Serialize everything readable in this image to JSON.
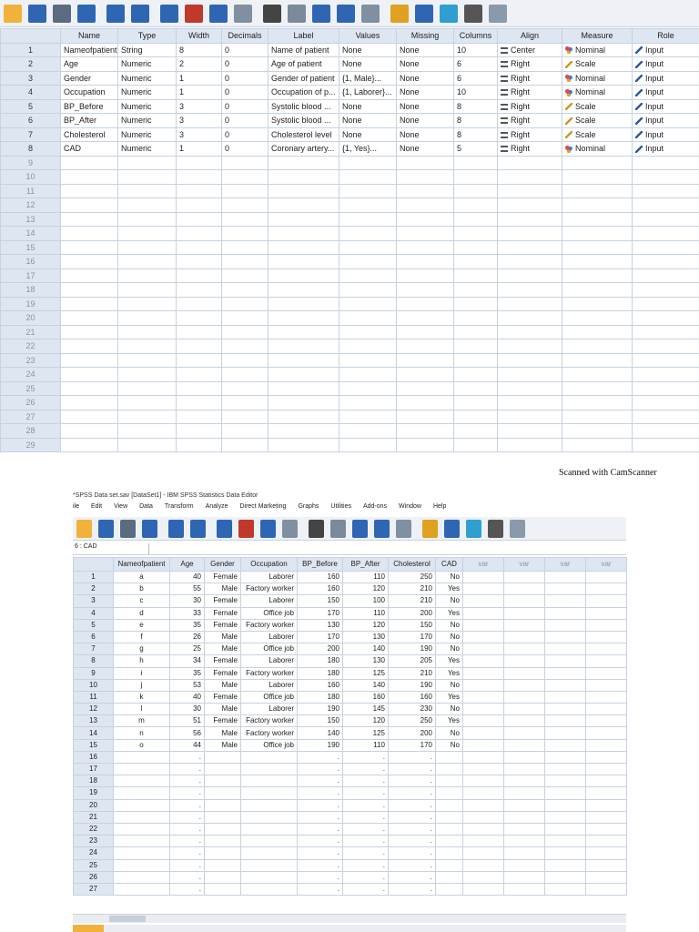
{
  "toolbar_icons": [
    "open-folder",
    "save",
    "print",
    "recall-dialog",
    "undo",
    "redo",
    "goto-case",
    "goto-variable",
    "variables",
    "descriptive",
    "find",
    "insert-cases",
    "insert-variable",
    "split-file",
    "weight-cases",
    "select-cases",
    "value-labels",
    "use-sets",
    "show-all",
    "spell-check"
  ],
  "variable_view": {
    "headers": [
      "Name",
      "Type",
      "Width",
      "Decimals",
      "Label",
      "Values",
      "Missing",
      "Columns",
      "Align",
      "Measure",
      "Role"
    ],
    "rows": [
      {
        "n": "1",
        "name": "Nameofpatient",
        "type": "String",
        "width": "8",
        "dec": "0",
        "label": "Name of patient",
        "values": "None",
        "missing": "None",
        "columns": "10",
        "align": "Center",
        "measure": "Nominal",
        "role": "Input"
      },
      {
        "n": "2",
        "name": "Age",
        "type": "Numeric",
        "width": "2",
        "dec": "0",
        "label": "Age of patient",
        "values": "None",
        "missing": "None",
        "columns": "6",
        "align": "Right",
        "measure": "Scale",
        "role": "Input"
      },
      {
        "n": "3",
        "name": "Gender",
        "type": "Numeric",
        "width": "1",
        "dec": "0",
        "label": "Gender of patient",
        "values": "{1, Male}...",
        "missing": "None",
        "columns": "6",
        "align": "Right",
        "measure": "Nominal",
        "role": "Input"
      },
      {
        "n": "4",
        "name": "Occupation",
        "type": "Numeric",
        "width": "1",
        "dec": "0",
        "label": "Occupation of p...",
        "values": "{1, Laborer}...",
        "missing": "None",
        "columns": "10",
        "align": "Right",
        "measure": "Nominal",
        "role": "Input"
      },
      {
        "n": "5",
        "name": "BP_Before",
        "type": "Numeric",
        "width": "3",
        "dec": "0",
        "label": "Systolic blood ...",
        "values": "None",
        "missing": "None",
        "columns": "8",
        "align": "Right",
        "measure": "Scale",
        "role": "Input"
      },
      {
        "n": "6",
        "name": "BP_After",
        "type": "Numeric",
        "width": "3",
        "dec": "0",
        "label": "Systolic blood ...",
        "values": "None",
        "missing": "None",
        "columns": "8",
        "align": "Right",
        "measure": "Scale",
        "role": "Input"
      },
      {
        "n": "7",
        "name": "Cholesterol",
        "type": "Numeric",
        "width": "3",
        "dec": "0",
        "label": "Cholesterol level",
        "values": "None",
        "missing": "None",
        "columns": "8",
        "align": "Right",
        "measure": "Scale",
        "role": "Input"
      },
      {
        "n": "8",
        "name": "CAD",
        "type": "Numeric",
        "width": "1",
        "dec": "0",
        "label": "Coronary artery...",
        "values": "{1, Yes}...",
        "missing": "None",
        "columns": "5",
        "align": "Right",
        "measure": "Nominal",
        "role": "Input"
      }
    ],
    "empty_rows": [
      "9",
      "10",
      "11",
      "12",
      "13",
      "14",
      "15",
      "16",
      "17",
      "18",
      "19",
      "20",
      "21",
      "22",
      "23",
      "24",
      "25",
      "26",
      "27",
      "28",
      "29"
    ]
  },
  "scanner_mark": "Scanned with CamScanner",
  "data_editor": {
    "title": "*SPSS Data set.sav [DataSet1] - IBM SPSS Statistics Data Editor",
    "menu": [
      "ile",
      "Edit",
      "View",
      "Data",
      "Transform",
      "Analyze",
      "Direct Marketing",
      "Graphs",
      "Utilities",
      "Add-ons",
      "Window",
      "Help"
    ],
    "cell_ref": "6 : CAD",
    "headers": [
      "Nameofpatient",
      "Age",
      "Gender",
      "Occupation",
      "BP_Before",
      "BP_After",
      "Cholesterol",
      "CAD",
      "var",
      "var",
      "var",
      "var"
    ],
    "rows": [
      [
        "1",
        "a",
        "40",
        "Female",
        "Laborer",
        "160",
        "110",
        "250",
        "No"
      ],
      [
        "2",
        "b",
        "55",
        "Male",
        "Factory worker",
        "160",
        "120",
        "210",
        "Yes"
      ],
      [
        "3",
        "c",
        "30",
        "Female",
        "Laborer",
        "150",
        "100",
        "210",
        "No"
      ],
      [
        "4",
        "d",
        "33",
        "Female",
        "Office job",
        "170",
        "110",
        "200",
        "Yes"
      ],
      [
        "5",
        "e",
        "35",
        "Female",
        "Factory worker",
        "130",
        "120",
        "150",
        "No"
      ],
      [
        "6",
        "f",
        "26",
        "Male",
        "Laborer",
        "170",
        "130",
        "170",
        "No"
      ],
      [
        "7",
        "g",
        "25",
        "Male",
        "Office job",
        "200",
        "140",
        "190",
        "No"
      ],
      [
        "8",
        "h",
        "34",
        "Female",
        "Laborer",
        "180",
        "130",
        "205",
        "Yes"
      ],
      [
        "9",
        "i",
        "35",
        "Female",
        "Factory worker",
        "180",
        "125",
        "210",
        "Yes"
      ],
      [
        "10",
        "j",
        "53",
        "Male",
        "Laborer",
        "160",
        "140",
        "190",
        "No"
      ],
      [
        "11",
        "k",
        "40",
        "Female",
        "Office job",
        "180",
        "160",
        "160",
        "Yes"
      ],
      [
        "12",
        "l",
        "30",
        "Male",
        "Laborer",
        "190",
        "145",
        "230",
        "No"
      ],
      [
        "13",
        "m",
        "51",
        "Female",
        "Factory worker",
        "150",
        "120",
        "250",
        "Yes"
      ],
      [
        "14",
        "n",
        "56",
        "Male",
        "Factory worker",
        "140",
        "125",
        "200",
        "No"
      ],
      [
        "15",
        "o",
        "44",
        "Male",
        "Office job",
        "190",
        "110",
        "170",
        "No"
      ]
    ],
    "empty_rows": [
      "16",
      "17",
      "18",
      "19",
      "20",
      "21",
      "22",
      "23",
      "24",
      "25",
      "26",
      "27"
    ],
    "missing_dot": "."
  }
}
